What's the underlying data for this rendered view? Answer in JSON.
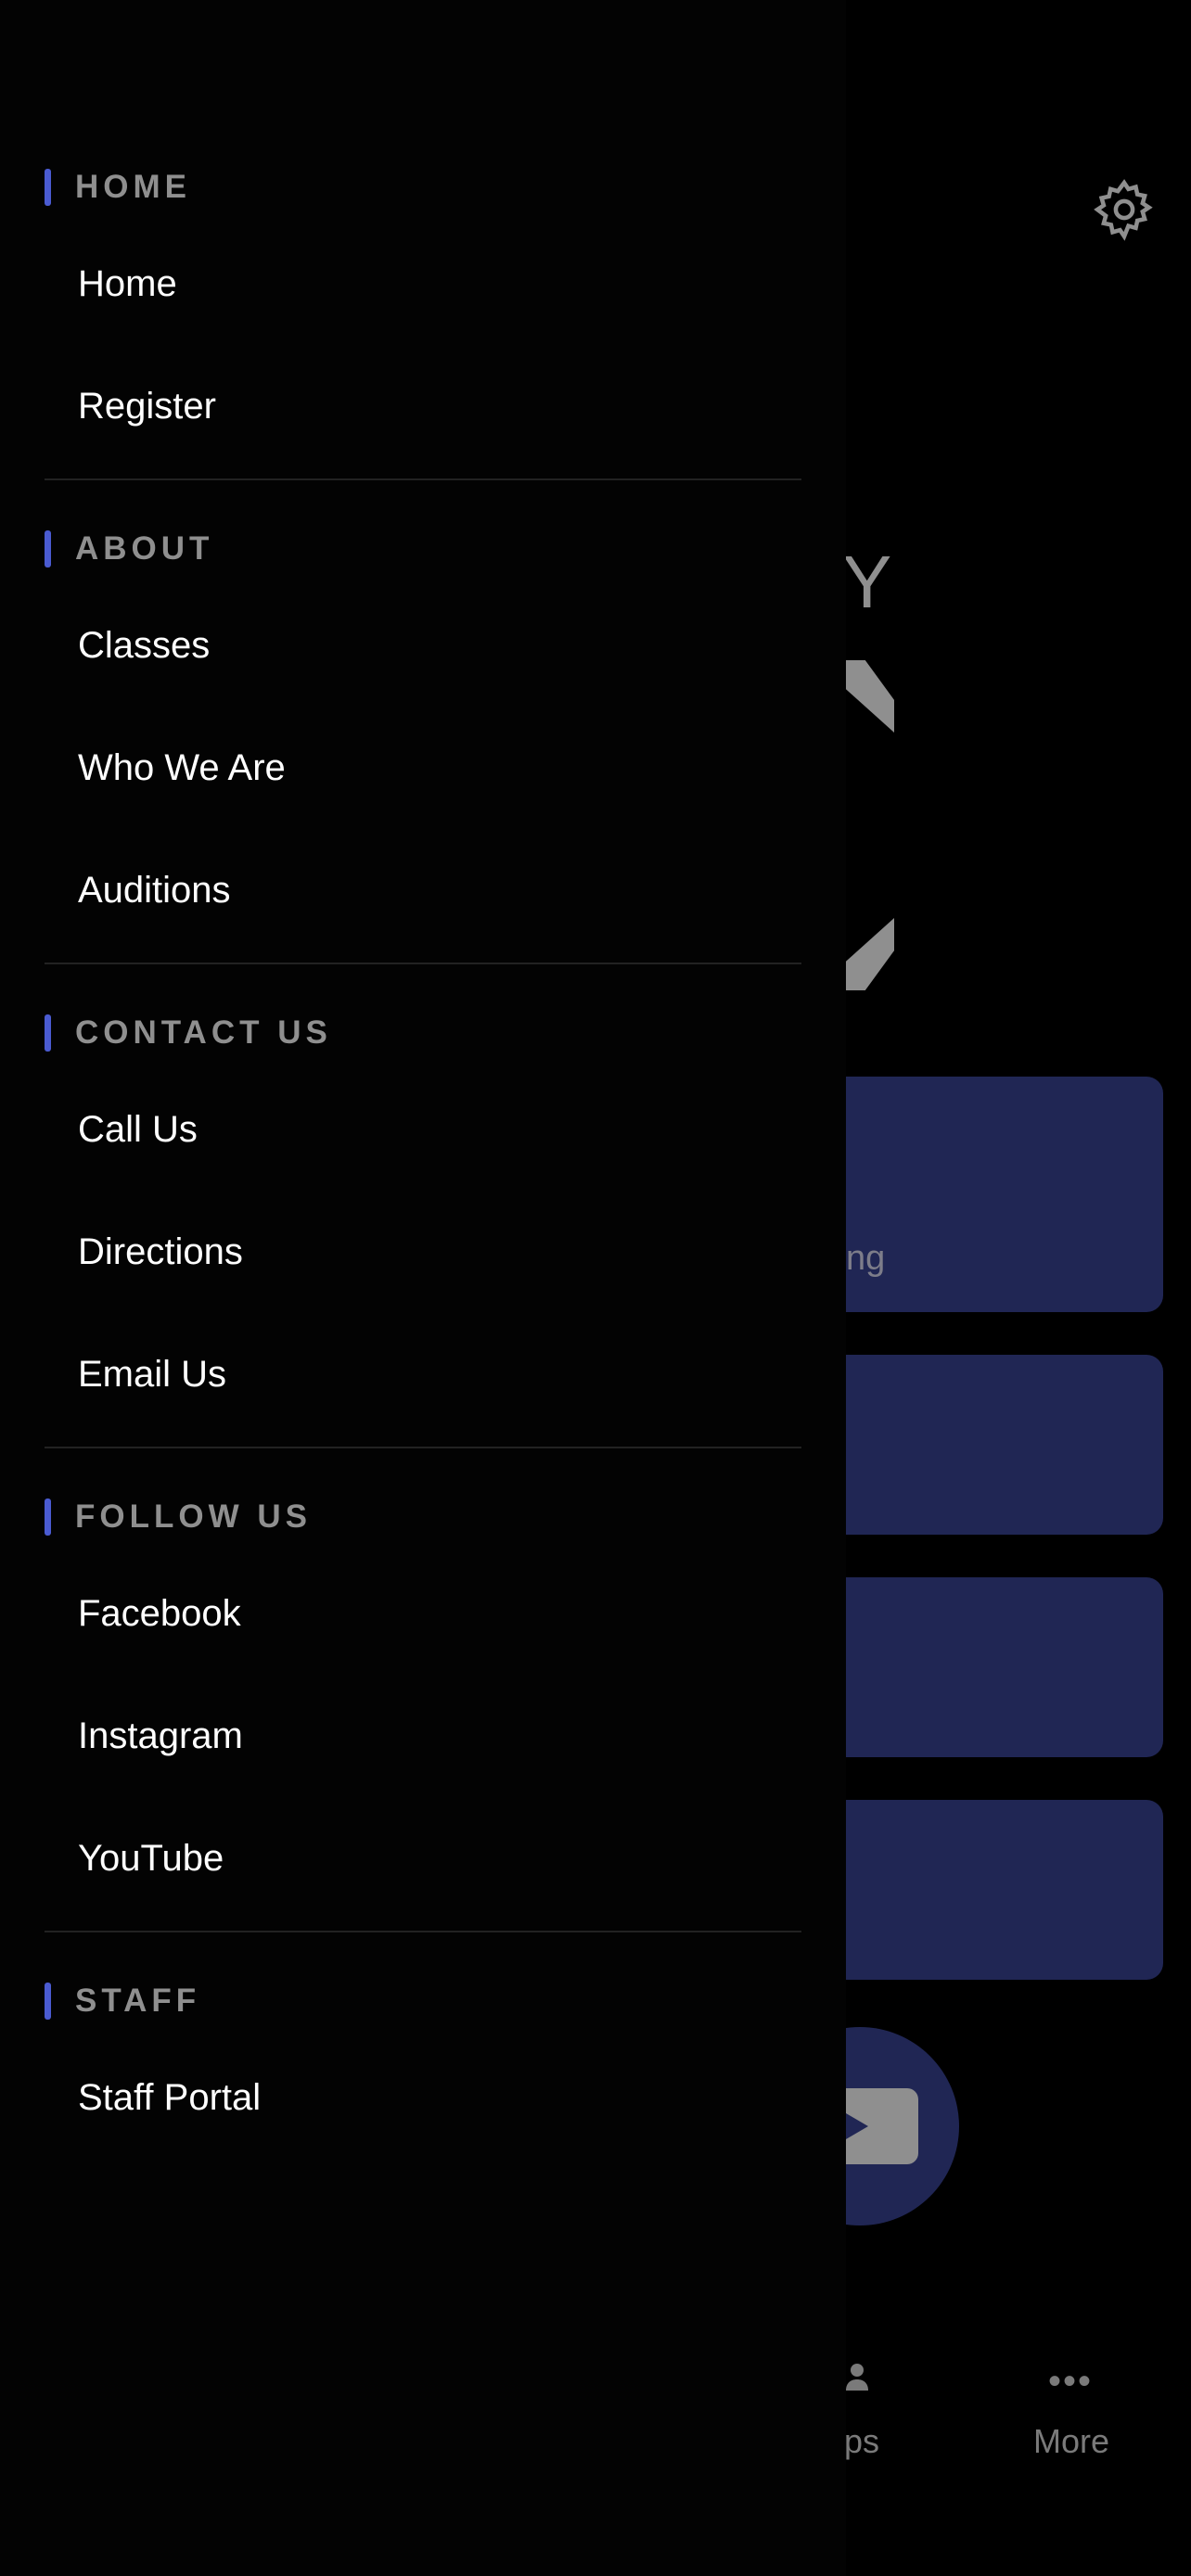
{
  "background": {
    "logo_letter": "Y",
    "card_text": "ng",
    "tabs": {
      "groups_label": "ups",
      "more_label": "More",
      "more_icon": "more-dots-icon"
    },
    "icons": {
      "settings": "gear-icon"
    },
    "colors": {
      "card": "#202654"
    }
  },
  "drawer": {
    "accent_color": "#4a5bd1",
    "sections": [
      {
        "title": "HOME",
        "items": [
          "Home",
          "Register"
        ]
      },
      {
        "title": "ABOUT",
        "items": [
          "Classes",
          "Who We Are",
          "Auditions"
        ]
      },
      {
        "title": "CONTACT US",
        "items": [
          "Call Us",
          "Directions",
          "Email Us"
        ]
      },
      {
        "title": "FOLLOW US",
        "items": [
          "Facebook",
          "Instagram",
          "YouTube"
        ]
      },
      {
        "title": "STAFF",
        "items": [
          "Staff Portal"
        ]
      }
    ]
  }
}
